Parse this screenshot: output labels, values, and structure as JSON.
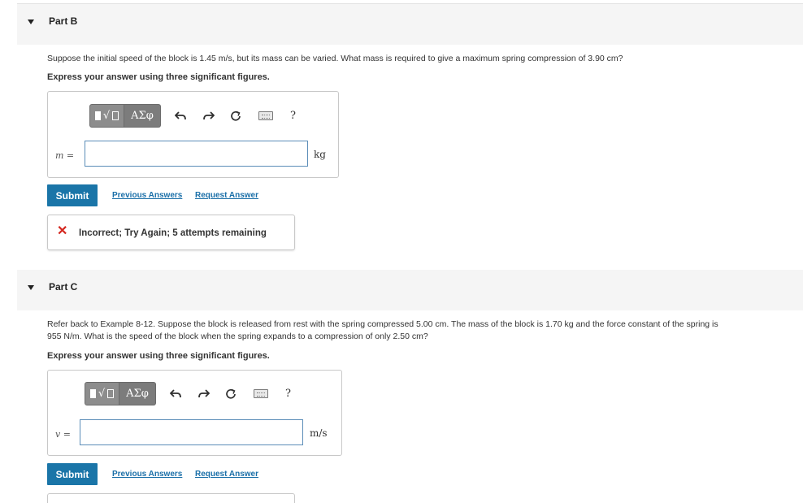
{
  "partB": {
    "title": "Part B",
    "question": "Suppose the initial speed of the block is 1.45 m/s, but its mass can be varied. What mass is required to give a maximum spring compression of 3.90 cm?",
    "instruction": "Express your answer using three significant figures.",
    "variable": "m =",
    "unit": "kg",
    "input_value": "",
    "submit_label": "Submit",
    "prev_answers_label": "Previous Answers",
    "request_answer_label": "Request Answer",
    "feedback": "Incorrect; Try Again; 5 attempts remaining"
  },
  "partC": {
    "title": "Part C",
    "question_line1": "Refer back to Example 8-12. Suppose the block is released from rest with the spring compressed 5.00 cm. The mass of the block is 1.70 kg and the force constant of the spring is",
    "question_line2": "955 N/m. What is the speed of the block when the spring expands to a compression of only 2.50 cm?",
    "instruction": "Express your answer using three significant figures.",
    "variable": "v =",
    "unit": "m/s",
    "input_value": "",
    "submit_label": "Submit",
    "prev_answers_label": "Previous Answers",
    "request_answer_label": "Request Answer"
  },
  "toolbar": {
    "greek_label": "ΑΣφ",
    "help_label": "?",
    "icons": [
      "templates-icon",
      "greek-letters-icon",
      "undo-icon",
      "redo-icon",
      "reset-icon",
      "keyboard-icon",
      "help-icon"
    ]
  },
  "colors": {
    "accent": "#1a75a8",
    "error": "#d4271f",
    "panel": "#f5f5f5"
  }
}
